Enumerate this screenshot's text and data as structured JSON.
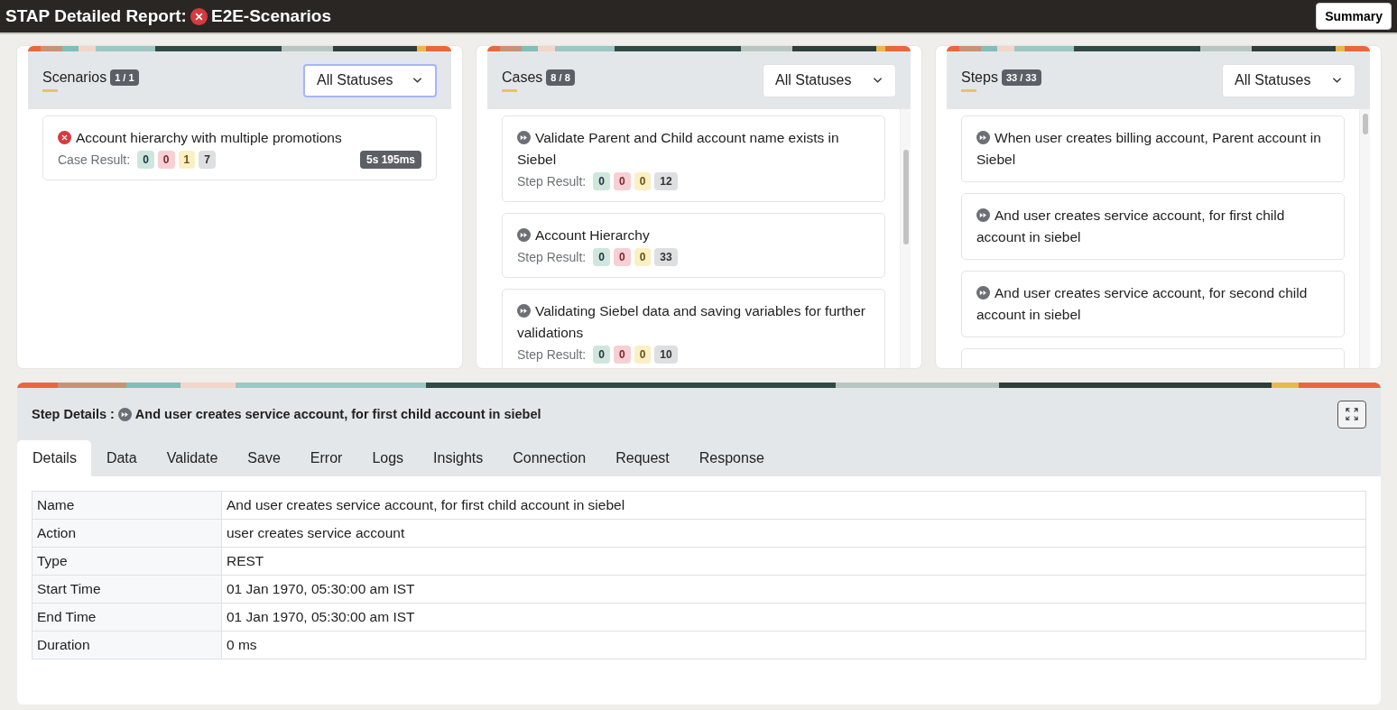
{
  "header": {
    "title": "STAP Detailed Report:",
    "failed": true,
    "suite": "E2E-Scenarios",
    "summary_button": "Summary"
  },
  "panels": [
    {
      "title": "Scenarios",
      "count": "1 / 1",
      "filter": {
        "value": "All Statuses",
        "focused": true
      },
      "items": [
        {
          "failed": true,
          "name": "Account hierarchy with multiple promotions",
          "result_label": "Case Result:",
          "counts": [
            "0",
            "0",
            "1",
            "7"
          ],
          "duration": "5s 195ms"
        }
      ]
    },
    {
      "title": "Cases",
      "count": "8 / 8",
      "filter": {
        "value": "All Statuses",
        "focused": false
      },
      "items": [
        {
          "failed": false,
          "name": "Validate Parent and Child account name exists in Siebel",
          "result_label": "Step Result:",
          "counts": [
            "0",
            "0",
            "0",
            "12"
          ]
        },
        {
          "failed": false,
          "name": "Account Hierarchy",
          "result_label": "Step Result:",
          "counts": [
            "0",
            "0",
            "0",
            "33"
          ]
        },
        {
          "failed": false,
          "name": "Validating Siebel data and saving variables for further validations",
          "result_label": "Step Result:",
          "counts": [
            "0",
            "0",
            "0",
            "10"
          ]
        }
      ]
    },
    {
      "title": "Steps",
      "count": "33 / 33",
      "filter": {
        "value": "All Statuses",
        "focused": false
      },
      "items": [
        {
          "failed": false,
          "name": "When user creates billing account, Parent account in Siebel"
        },
        {
          "failed": false,
          "name": "And user creates service account, for first child account in siebel"
        },
        {
          "failed": false,
          "name": "And user creates service account, for second child account in siebel"
        }
      ]
    }
  ],
  "details": {
    "label": "Step Details :",
    "failed": false,
    "name": "And user creates service account, for first child account in siebel",
    "tabs": [
      {
        "label": "Details",
        "selected": true
      },
      {
        "label": "Data",
        "selected": false
      },
      {
        "label": "Validate",
        "selected": false
      },
      {
        "label": "Save",
        "selected": false
      },
      {
        "label": "Error",
        "selected": false
      },
      {
        "label": "Logs",
        "selected": false
      },
      {
        "label": "Insights",
        "selected": false
      },
      {
        "label": "Connection",
        "selected": false
      },
      {
        "label": "Request",
        "selected": false
      },
      {
        "label": "Response",
        "selected": false
      }
    ],
    "rows": [
      {
        "key": "Name",
        "value": "And user creates service account, for first child account in siebel"
      },
      {
        "key": "Action",
        "value": "user creates service account"
      },
      {
        "key": "Type",
        "value": "REST"
      },
      {
        "key": "Start Time",
        "value": "01 Jan 1970, 05:30:00 am IST"
      },
      {
        "key": "End Time",
        "value": "01 Jan 1970, 05:30:00 am IST"
      },
      {
        "key": "Duration",
        "value": "0 ms"
      }
    ]
  }
}
